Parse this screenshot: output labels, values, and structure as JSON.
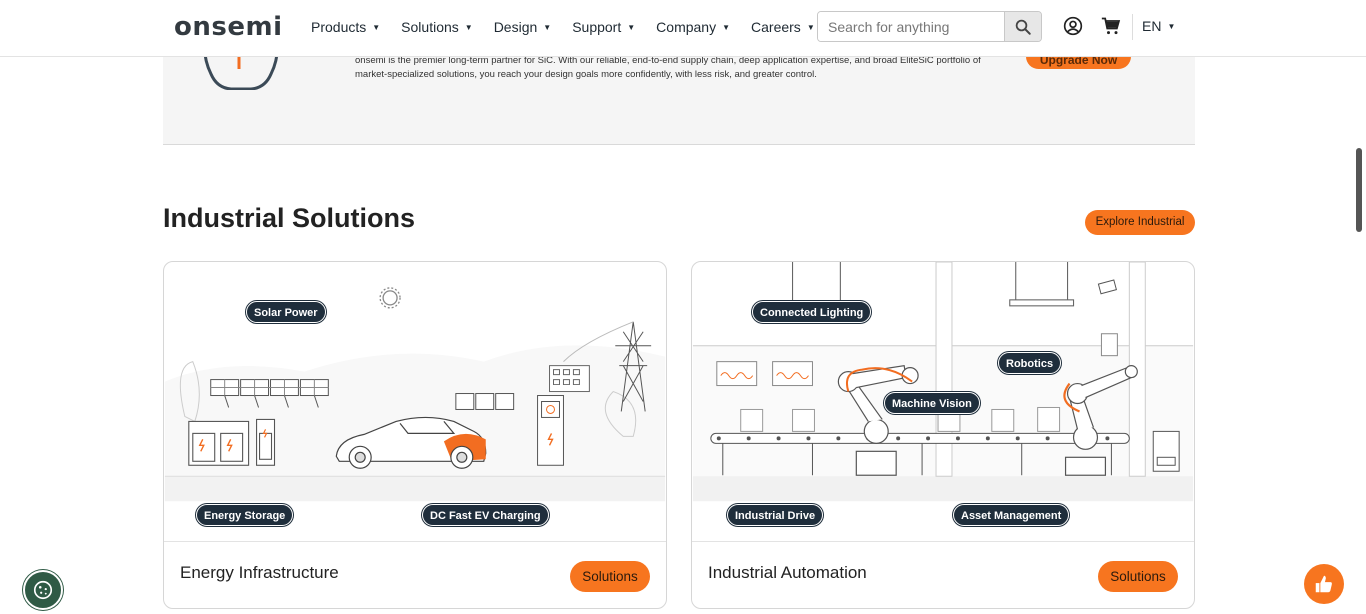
{
  "header": {
    "logo_text": "onsemi",
    "nav": [
      {
        "label": "Products"
      },
      {
        "label": "Solutions"
      },
      {
        "label": "Design"
      },
      {
        "label": "Support"
      },
      {
        "label": "Company"
      },
      {
        "label": "Careers"
      }
    ],
    "search_placeholder": "Search for anything",
    "language": "EN"
  },
  "banner": {
    "text": "onsemi is the premier long-term partner for SiC. With our reliable, end-to-end supply chain, deep application expertise, and broad EliteSiC portfolio of market-specialized solutions, you reach your design goals more confidently, with less risk, and greater control.",
    "button_label": "Upgrade Now"
  },
  "section": {
    "title": "Industrial Solutions",
    "explore_label": "Explore Industrial"
  },
  "cards": [
    {
      "title": "Energy Infrastructure",
      "button_label": "Solutions",
      "tags": [
        "Solar Power",
        "Energy Storage",
        "DC Fast EV Charging"
      ]
    },
    {
      "title": "Industrial Automation",
      "button_label": "Solutions",
      "tags": [
        "Connected Lighting",
        "Robotics",
        "Machine Vision",
        "Industrial Drive",
        "Asset Management"
      ]
    }
  ],
  "colors": {
    "accent": "#f7751f",
    "tag_bg": "#1f2e3c",
    "cookie_bg": "#2f5a45"
  },
  "icons": [
    "search-icon",
    "user-icon",
    "cart-icon",
    "cookie-icon",
    "thumbs-up-icon"
  ]
}
